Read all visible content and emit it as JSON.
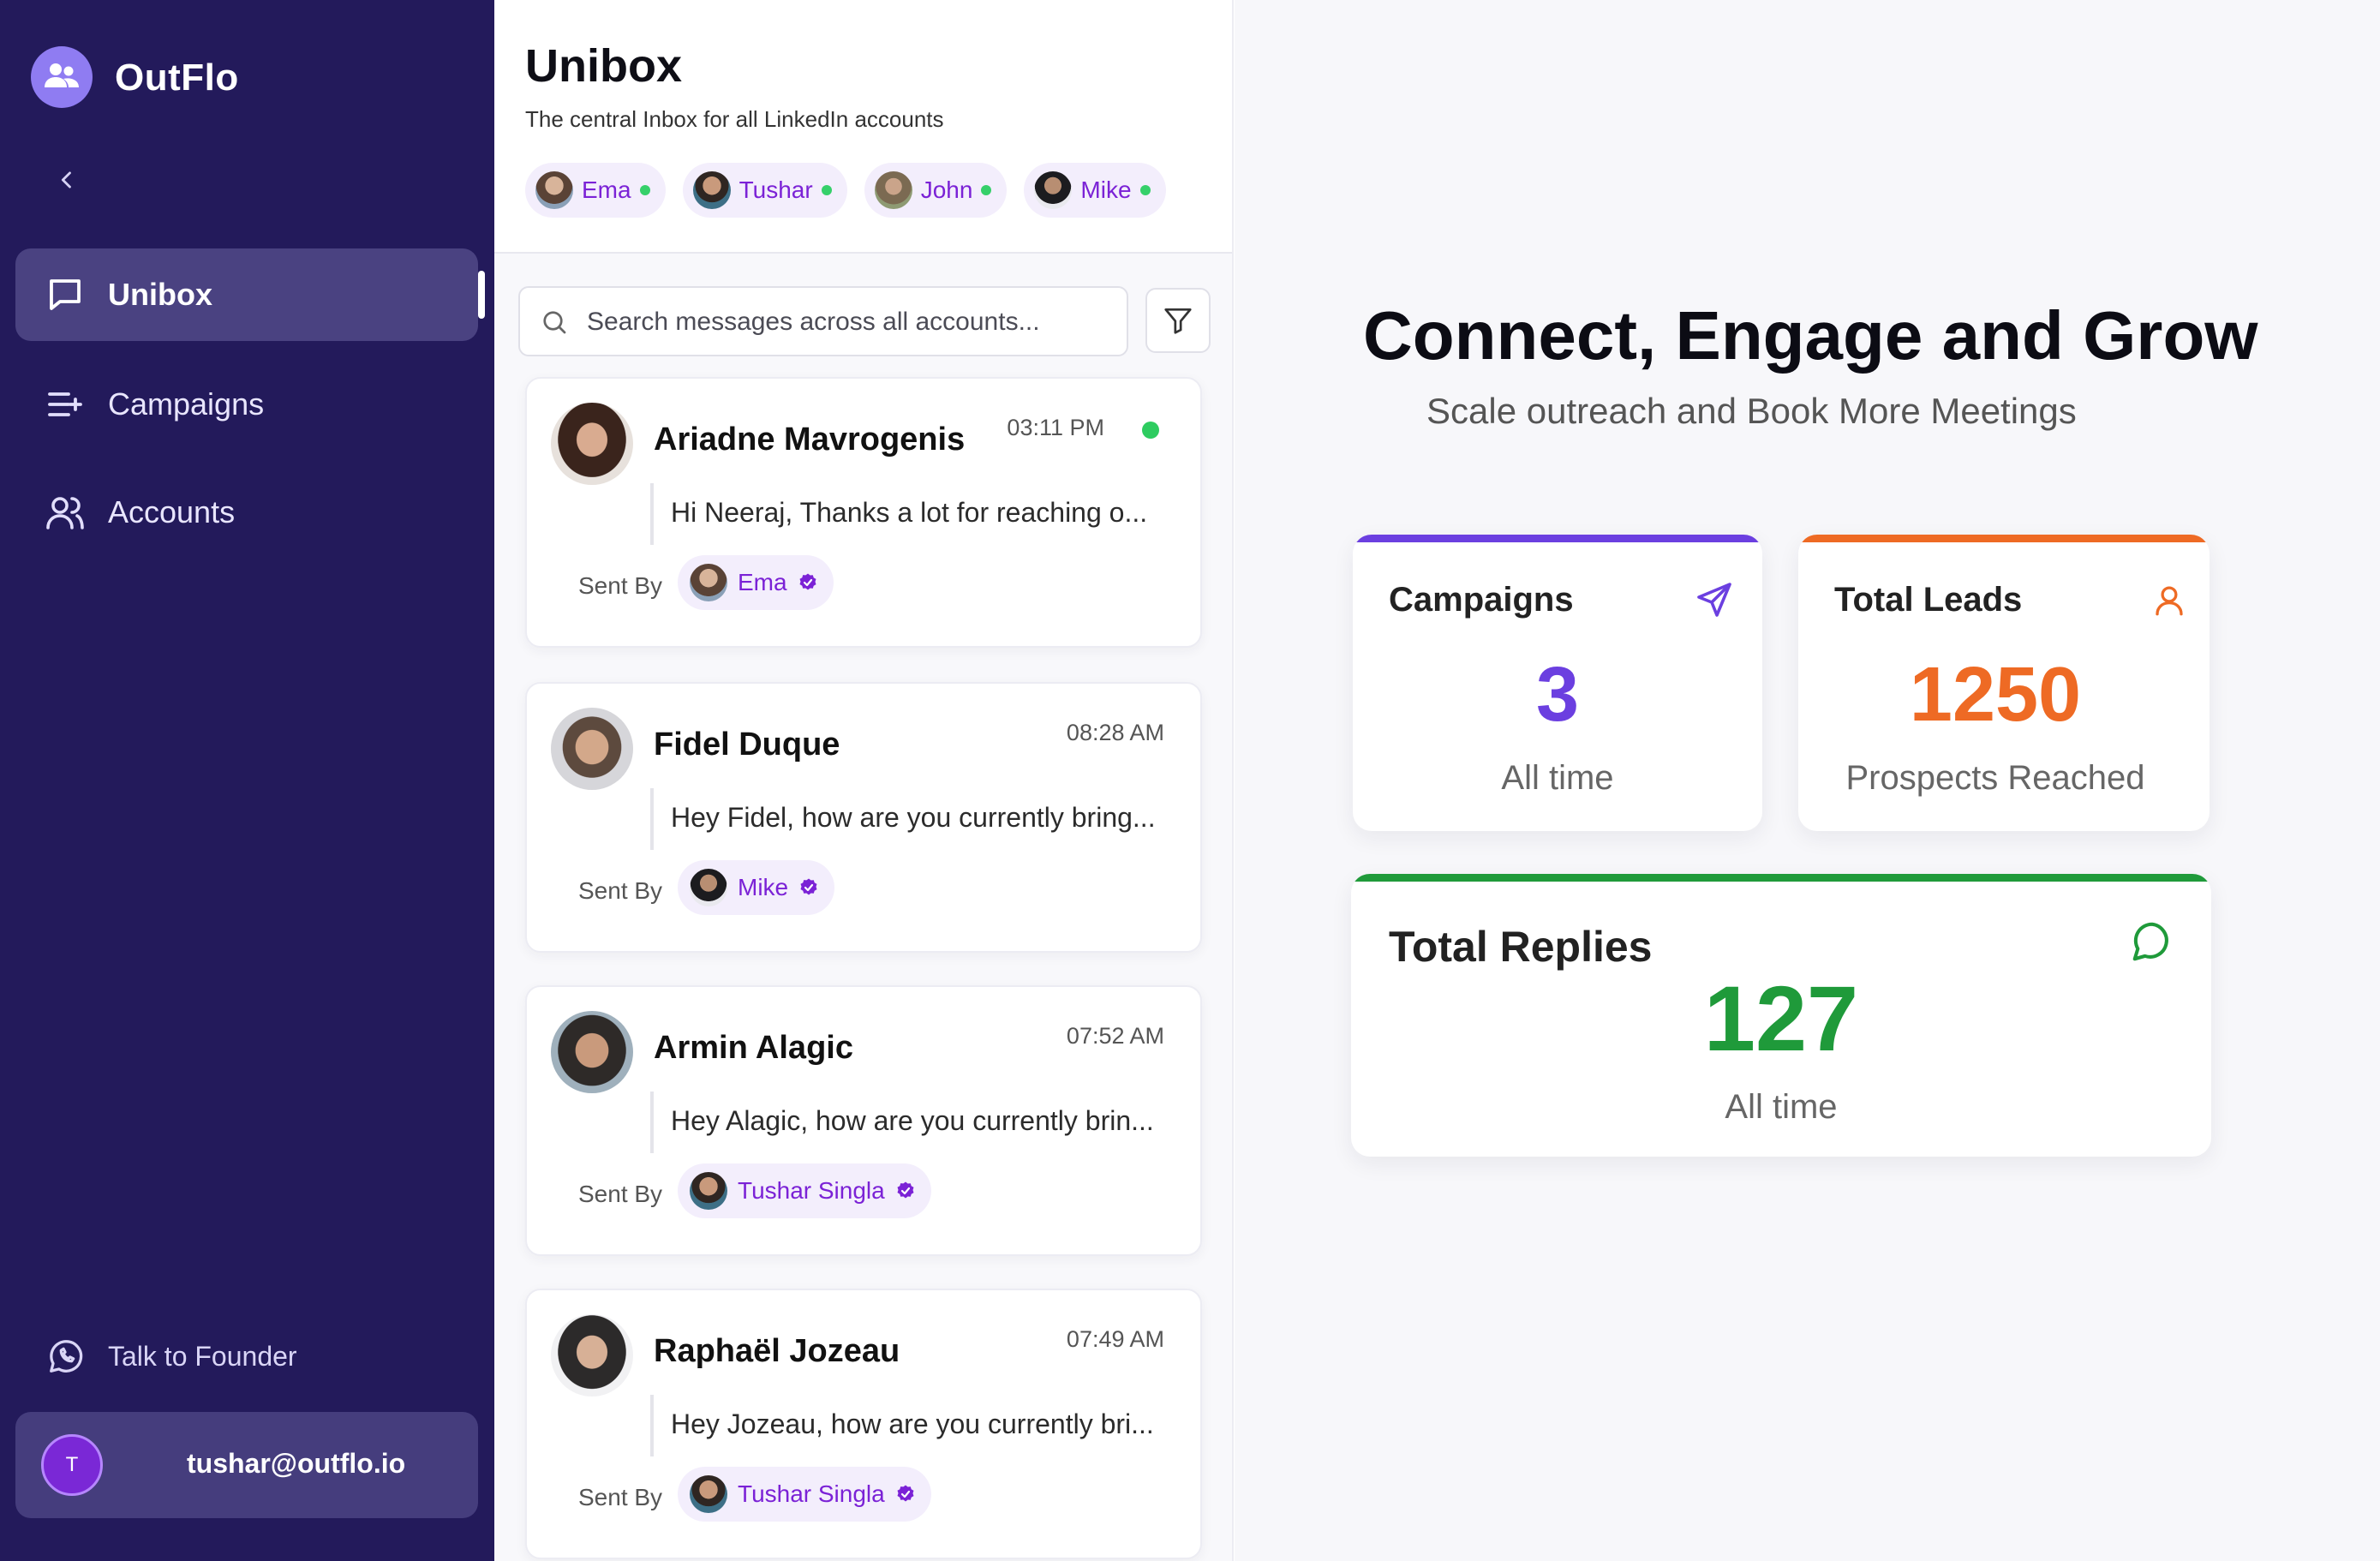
{
  "brand": {
    "name": "OutFlo"
  },
  "sidebar": {
    "nav": [
      {
        "label": "Unibox",
        "icon": "message-square-icon",
        "active": true
      },
      {
        "label": "Campaigns",
        "icon": "list-plus-icon",
        "active": false
      },
      {
        "label": "Accounts",
        "icon": "users-icon",
        "active": false
      }
    ],
    "talk_to_founder": "Talk to Founder",
    "user": {
      "initial": "T",
      "email": "tushar@outflo.io"
    }
  },
  "unibox": {
    "title": "Unibox",
    "subtitle": "The central Inbox for all LinkedIn accounts",
    "accounts": [
      {
        "name": "Ema",
        "online": true
      },
      {
        "name": "Tushar",
        "online": true
      },
      {
        "name": "John",
        "online": true
      },
      {
        "name": "Mike",
        "online": true
      }
    ],
    "search_placeholder": "Search messages across all accounts...",
    "sent_by_label": "Sent By",
    "conversations": [
      {
        "name": "Ariadne Mavrogenis",
        "time": "03:11 PM",
        "unread": true,
        "preview": "Hi Neeraj, Thanks a lot for reaching o...",
        "sender": "Ema"
      },
      {
        "name": "Fidel Duque",
        "time": "08:28 AM",
        "unread": false,
        "preview": "Hey Fidel, how are you currently bring...",
        "sender": "Mike"
      },
      {
        "name": "Armin Alagic",
        "time": "07:52 AM",
        "unread": false,
        "preview": "Hey Alagic, how are you currently brin...",
        "sender": "Tushar Singla"
      },
      {
        "name": "Raphaël Jozeau",
        "time": "07:49 AM",
        "unread": false,
        "preview": "Hey Jozeau, how are you currently bri...",
        "sender": "Tushar Singla"
      }
    ]
  },
  "dashboard": {
    "headline": "Connect, Engage and Grow",
    "subheadline": "Scale outreach and Book More Meetings",
    "stats": {
      "campaigns": {
        "label": "Campaigns",
        "value": "3",
        "caption": "All time",
        "color": "#6b3fe0",
        "icon": "send-icon"
      },
      "leads": {
        "label": "Total Leads",
        "value": "1250",
        "caption": "Prospects Reached",
        "color": "#ee6a24",
        "icon": "user-icon"
      },
      "replies": {
        "label": "Total Replies",
        "value": "127",
        "caption": "All time",
        "color": "#1f9a3a",
        "icon": "chat-bubble-icon"
      }
    }
  },
  "colors": {
    "sidebar_bg": "#231a5b",
    "accent_purple": "#7b22d6",
    "online_green": "#2ecc60"
  }
}
